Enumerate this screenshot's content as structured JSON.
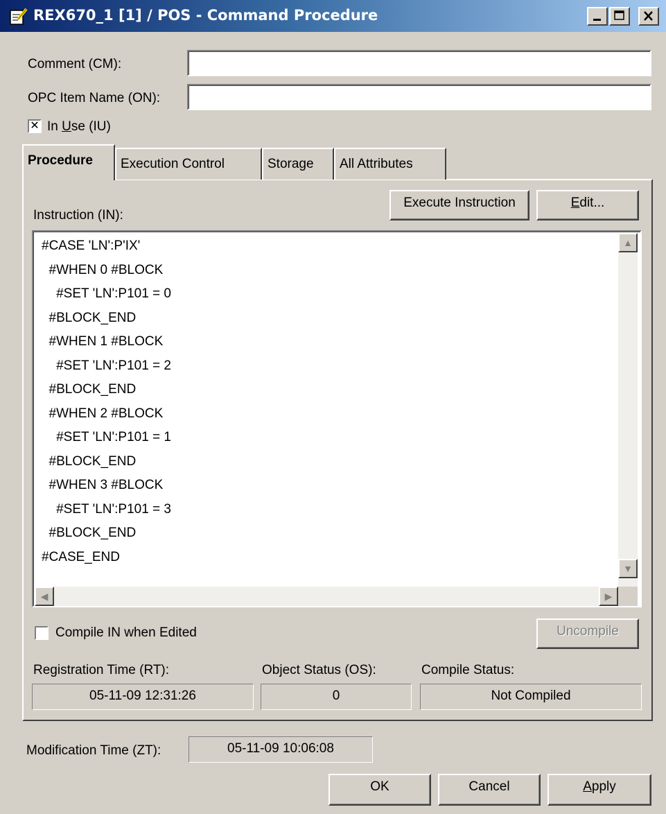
{
  "window": {
    "title": "REX670_1 [1] / POS - Command Procedure",
    "icon": "edit-document-icon"
  },
  "fields": {
    "comment_label": "Comment (CM):",
    "comment_value": "",
    "opc_label": "OPC Item Name (ON):",
    "opc_value": "",
    "in_use_pre": "In ",
    "in_use_u": "U",
    "in_use_post": "se (IU)",
    "in_use_checked": true
  },
  "tabs": [
    {
      "label": "Procedure",
      "active": true
    },
    {
      "label": "Execution Control",
      "active": false
    },
    {
      "label": "Storage",
      "active": false
    },
    {
      "label": "All Attributes",
      "active": false
    }
  ],
  "procedure": {
    "instruction_label": "Instruction (IN):",
    "execute_button": "Execute Instruction",
    "edit_button_u": "E",
    "edit_button_rest": "dit...",
    "code_lines": [
      "#CASE 'LN':P'IX'",
      "  #WHEN 0 #BLOCK",
      "    #SET 'LN':P101 = 0",
      "  #BLOCK_END",
      "  #WHEN 1 #BLOCK",
      "    #SET 'LN':P101 = 2",
      "  #BLOCK_END",
      "  #WHEN 2 #BLOCK",
      "    #SET 'LN':P101 = 1",
      "  #BLOCK_END",
      "  #WHEN 3 #BLOCK",
      "    #SET 'LN':P101 = 3",
      "  #BLOCK_END",
      "#CASE_END"
    ],
    "compile_checkbox_label": "Compile IN when Edited",
    "compile_checked": false,
    "uncompile_button": "Uncompile",
    "registration_time_label": "Registration Time (RT):",
    "registration_time_value": "05-11-09 12:31:26",
    "object_status_label": "Object Status (OS):",
    "object_status_value": "0",
    "compile_status_label": "Compile Status:",
    "compile_status_value": "Not Compiled"
  },
  "footer": {
    "modification_time_label": "Modification Time (ZT):",
    "modification_time_value": "05-11-09 10:06:08",
    "ok_button": "OK",
    "cancel_button": "Cancel",
    "apply_button_u": "A",
    "apply_button_rest": "pply"
  },
  "colors": {
    "titlebar_start": "#0a246a",
    "titlebar_end": "#a6caf0",
    "face": "#d4d0c8"
  }
}
